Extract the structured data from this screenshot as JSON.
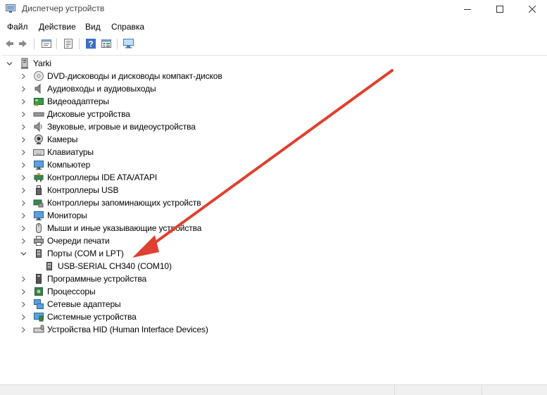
{
  "window": {
    "title": "Диспетчер устройств",
    "controls": [
      "minimize",
      "maximize",
      "close"
    ]
  },
  "menu": [
    "Файл",
    "Действие",
    "Вид",
    "Справка"
  ],
  "toolbar": [
    "back-icon",
    "forward-icon",
    "properties-icon",
    "update-driver-icon",
    "help-icon",
    "view-icon",
    "monitor-scan-icon"
  ],
  "tree": {
    "root": "Yarki",
    "categories": [
      {
        "label": "DVD-дисководы и дисководы компакт-дисков",
        "icon": "dvd-drive-icon"
      },
      {
        "label": "Аудиовходы и аудиовыходы",
        "icon": "audio-io-icon"
      },
      {
        "label": "Видеоадаптеры",
        "icon": "display-adapter-icon"
      },
      {
        "label": "Дисковые устройства",
        "icon": "disk-drive-icon"
      },
      {
        "label": "Звуковые, игровые и видеоустройства",
        "icon": "sound-icon"
      },
      {
        "label": "Камеры",
        "icon": "camera-icon"
      },
      {
        "label": "Клавиатуры",
        "icon": "keyboard-icon"
      },
      {
        "label": "Компьютер",
        "icon": "computer-icon"
      },
      {
        "label": "Контроллеры IDE ATA/ATAPI",
        "icon": "ide-controller-icon"
      },
      {
        "label": "Контроллеры USB",
        "icon": "usb-icon"
      },
      {
        "label": "Контроллеры запоминающих устройств",
        "icon": "storage-controller-icon"
      },
      {
        "label": "Мониторы",
        "icon": "monitor-icon"
      },
      {
        "label": "Мыши и иные указывающие устройства",
        "icon": "mouse-icon"
      },
      {
        "label": "Очереди печати",
        "icon": "printer-icon"
      },
      {
        "label": "Порты (COM и LPT)",
        "icon": "port-icon",
        "expanded": true,
        "children": [
          "USB-SERIAL CH340 (COM10)"
        ]
      },
      {
        "label": "Программные устройства",
        "icon": "software-device-icon"
      },
      {
        "label": "Процессоры",
        "icon": "processor-icon"
      },
      {
        "label": "Сетевые адаптеры",
        "icon": "network-adapter-icon"
      },
      {
        "label": "Системные устройства",
        "icon": "system-device-icon"
      },
      {
        "label": "Устройства HID (Human Interface Devices)",
        "icon": "hid-icon"
      }
    ]
  },
  "colors": {
    "annotation_arrow": "#e0402f",
    "icon_blue": "#3b7fd4",
    "icon_gray": "#6e6e6e"
  }
}
